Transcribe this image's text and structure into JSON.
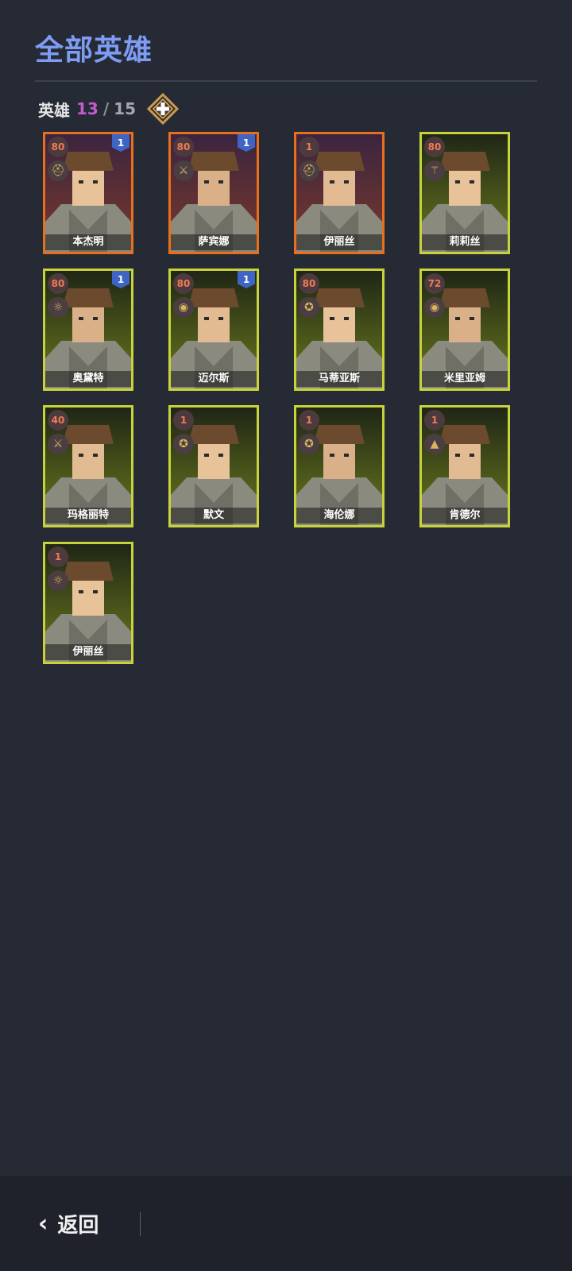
{
  "header": {
    "title": "全部英雄"
  },
  "summary": {
    "label": "英雄",
    "current": "13",
    "separator": "/",
    "max": "15"
  },
  "heroes": [
    {
      "name": "本杰明",
      "level": "80",
      "rank": "1",
      "frame": "orange",
      "class_icon": "helmet-icon"
    },
    {
      "name": "萨宾娜",
      "level": "80",
      "rank": "1",
      "frame": "orange",
      "class_icon": "sword-icon"
    },
    {
      "name": "伊丽丝",
      "level": "1",
      "rank": "",
      "frame": "orange",
      "class_icon": "helmet-icon"
    },
    {
      "name": "莉莉丝",
      "level": "80",
      "rank": "",
      "frame": "yellow",
      "class_icon": "staff-icon"
    },
    {
      "name": "奥黛特",
      "level": "80",
      "rank": "1",
      "frame": "yellow",
      "class_icon": "sun-icon"
    },
    {
      "name": "迈尔斯",
      "level": "80",
      "rank": "1",
      "frame": "yellow",
      "class_icon": "eye-icon"
    },
    {
      "name": "马蒂亚斯",
      "level": "80",
      "rank": "",
      "frame": "yellow",
      "class_icon": "pentagram-icon"
    },
    {
      "name": "米里亚姆",
      "level": "72",
      "rank": "",
      "frame": "yellow",
      "class_icon": "eye-icon"
    },
    {
      "name": "玛格丽特",
      "level": "40",
      "rank": "",
      "frame": "yellow",
      "class_icon": "sword-icon"
    },
    {
      "name": "默文",
      "level": "1",
      "rank": "",
      "frame": "yellow",
      "class_icon": "pentagram-icon"
    },
    {
      "name": "海伦娜",
      "level": "1",
      "rank": "",
      "frame": "yellow",
      "class_icon": "pentagram-icon"
    },
    {
      "name": "肯德尔",
      "level": "1",
      "rank": "",
      "frame": "yellow",
      "class_icon": "hat-icon"
    },
    {
      "name": "伊丽丝",
      "level": "1",
      "rank": "",
      "frame": "yellow",
      "class_icon": "sun-icon"
    }
  ],
  "footer": {
    "back_label": "返回"
  },
  "colors": {
    "accent": "#7f9cf5",
    "count": "#c45ccd",
    "frame_orange": "#ea6f1c",
    "frame_yellow": "#c8d33a",
    "rank_badge": "#3e64c6"
  }
}
